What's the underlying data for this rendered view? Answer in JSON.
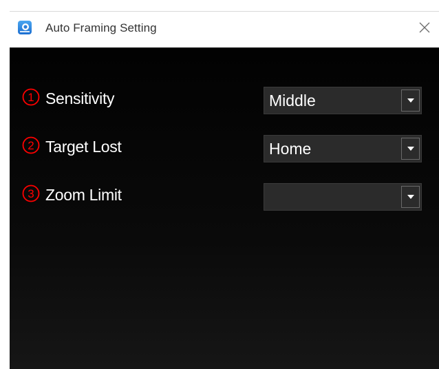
{
  "window": {
    "title": "Auto Framing Setting",
    "app_icon": "camera-app-icon",
    "close_icon": "close-icon"
  },
  "settings": [
    {
      "number": "1",
      "label": "Sensitivity",
      "value": "Middle"
    },
    {
      "number": "2",
      "label": "Target Lost",
      "value": "Home"
    },
    {
      "number": "3",
      "label": "Zoom Limit",
      "value": ""
    }
  ],
  "colors": {
    "number_circle": "#ff0000",
    "content_background": "#050505",
    "select_background": "#2b2b2b",
    "text": "#ffffff"
  }
}
